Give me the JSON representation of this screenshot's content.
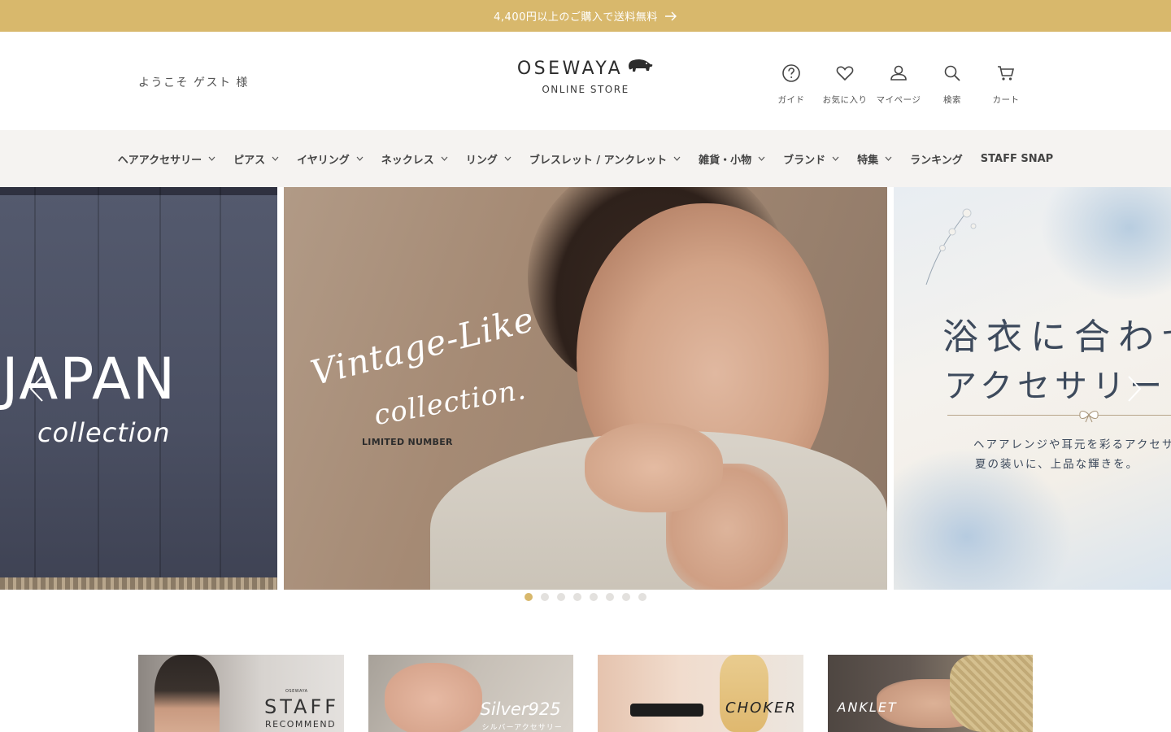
{
  "announcement": {
    "text": "4,400円以上のご購入で送料無料",
    "arrow_icon": "arrow-right-icon"
  },
  "header": {
    "welcome": "ようこそ ゲスト 様",
    "logo_main": "OSEWAYA",
    "logo_sub": "ONLINE STORE",
    "icons": [
      {
        "icon": "help-circle-icon",
        "label": "ガイド"
      },
      {
        "icon": "heart-icon",
        "label": "お気に入り"
      },
      {
        "icon": "user-icon",
        "label": "マイページ"
      },
      {
        "icon": "search-icon",
        "label": "検索"
      },
      {
        "icon": "cart-icon",
        "label": "カート"
      }
    ]
  },
  "nav": {
    "items": [
      {
        "label": "ヘアアクセサリー",
        "dropdown": true
      },
      {
        "label": "ピアス",
        "dropdown": true
      },
      {
        "label": "イヤリング",
        "dropdown": true
      },
      {
        "label": "ネックレス",
        "dropdown": true
      },
      {
        "label": "リング",
        "dropdown": true
      },
      {
        "label": "ブレスレット / アンクレット",
        "dropdown": true
      },
      {
        "label": "雑貨・小物",
        "dropdown": true
      },
      {
        "label": "ブランド",
        "dropdown": true
      },
      {
        "label": "特集",
        "dropdown": true
      },
      {
        "label": "ランキング",
        "dropdown": false
      },
      {
        "label": "STAFF SNAP",
        "dropdown": false
      }
    ]
  },
  "hero": {
    "slides": {
      "left": {
        "title": "JAPAN",
        "subtitle": "collection"
      },
      "center": {
        "title_line1": "Vintage-Like",
        "title_line2": "collection.",
        "tag": "LIMITED NUMBER"
      },
      "right": {
        "title_line1": "浴衣に合わせ",
        "title_line2": "アクセサリー",
        "desc_line1": "ヘアアレンジや耳元を彩るアクセサ",
        "desc_line2": "夏の装いに、上品な輝きを。"
      }
    },
    "prev_icon": "chevron-left-icon",
    "next_icon": "chevron-right-icon",
    "dot_count": 8,
    "active_dot": 1
  },
  "categories": [
    {
      "label": "STAFF",
      "sublabel": "RECOMMEND",
      "brand": "OSEWAYA"
    },
    {
      "label": "Silver925",
      "sublabel": "シルバーアクセサリー"
    },
    {
      "label": "CHOKER"
    },
    {
      "label": "ANKLET"
    }
  ],
  "colors": {
    "accent": "#d8b86c",
    "nav_bg": "#f5f3f1",
    "dot_inactive": "#e3e1de"
  }
}
